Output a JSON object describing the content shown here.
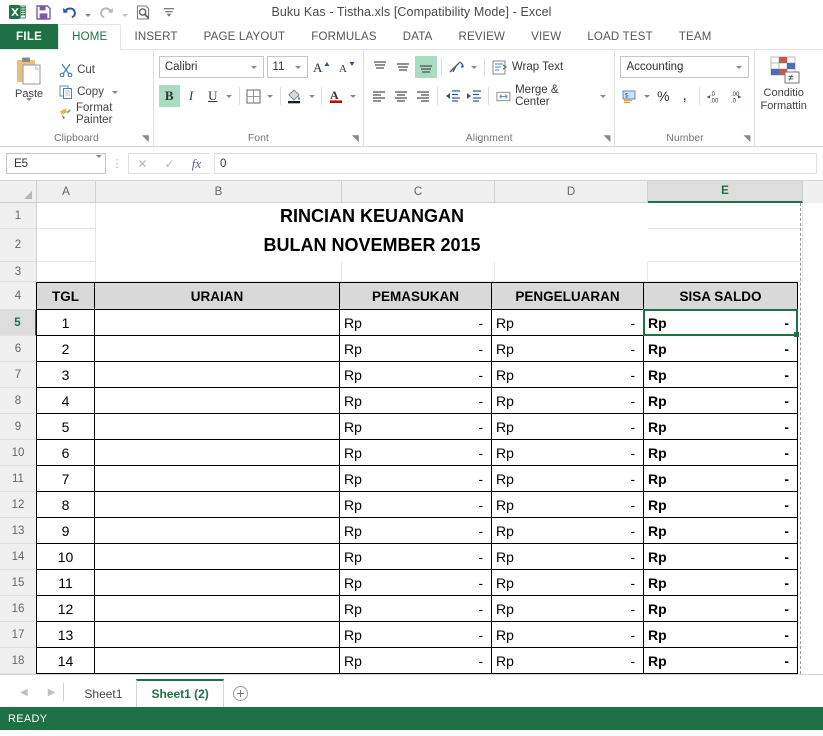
{
  "window": {
    "title": "Buku Kas - Tistha.xls  [Compatibility Mode] - Excel",
    "accent_color": "#1e7145"
  },
  "qat": {
    "items": [
      {
        "name": "excel-logo-icon",
        "label": "X"
      },
      {
        "name": "save-icon",
        "label": "Save"
      },
      {
        "name": "undo-icon",
        "label": "Undo"
      },
      {
        "name": "redo-icon",
        "label": "Redo"
      },
      {
        "name": "print-preview-icon",
        "label": "Print Preview and Print"
      },
      {
        "name": "customize-qat-icon",
        "label": "Customize Quick Access Toolbar"
      }
    ]
  },
  "ribbon": {
    "tabs": [
      {
        "label": "FILE",
        "active": false
      },
      {
        "label": "HOME",
        "active": true
      },
      {
        "label": "INSERT",
        "active": false
      },
      {
        "label": "PAGE LAYOUT",
        "active": false
      },
      {
        "label": "FORMULAS",
        "active": false
      },
      {
        "label": "DATA",
        "active": false
      },
      {
        "label": "REVIEW",
        "active": false
      },
      {
        "label": "VIEW",
        "active": false
      },
      {
        "label": "LOAD TEST",
        "active": false
      },
      {
        "label": "TEAM",
        "active": false
      }
    ],
    "clipboard": {
      "group_label": "Clipboard",
      "paste_label": "Paste",
      "cut_label": "Cut",
      "copy_label": "Copy",
      "format_painter_label": "Format Painter"
    },
    "font": {
      "group_label": "Font",
      "font_name": "Calibri",
      "font_size": "11",
      "bold_label": "B",
      "italic_label": "I",
      "underline_label": "U",
      "grow_font_label": "A",
      "shrink_font_label": "A",
      "borders_label": "Borders",
      "fill_color_label": "Fill Color",
      "font_color_label": "A",
      "bold_active": true
    },
    "alignment": {
      "group_label": "Alignment",
      "wrap_text_label": "Wrap Text",
      "merge_center_label": "Merge & Center",
      "top_align_label": "Top Align",
      "middle_align_label": "Middle Align",
      "bottom_align_label": "Bottom Align",
      "orientation_label": "Orientation",
      "align_left_label": "Align Left",
      "align_center_label": "Center",
      "align_right_label": "Align Right",
      "decrease_indent_label": "Decrease Indent",
      "increase_indent_label": "Increase Indent"
    },
    "number": {
      "group_label": "Number",
      "format": "Accounting",
      "accounting_label": "Accounting Number Format",
      "percent_label": "%",
      "comma_label": ",",
      "increase_decimal_label": "Increase Decimal",
      "decrease_decimal_label": "Decrease Decimal"
    },
    "styles": {
      "conditional_formatting_line1": "Conditio",
      "conditional_formatting_line2": "Formattin"
    }
  },
  "formula_bar": {
    "name_box": "E5",
    "cancel_label": "Cancel",
    "enter_label": "Enter",
    "fx_label": "fx",
    "value": "0"
  },
  "grid": {
    "columns": [
      "A",
      "B",
      "C",
      "D",
      "E"
    ],
    "selected_column": "E",
    "selected_row": "5",
    "active_cell": "E5",
    "doc_title_line1": "RINCIAN KEUANGAN",
    "doc_title_line2": "BULAN NOVEMBER 2015",
    "headers": [
      "TGL",
      "URAIAN",
      "PEMASUKAN",
      "PENGELUARAN",
      "SISA SALDO"
    ],
    "currency_symbol": "Rp",
    "zero_dash": "-",
    "row_numbers": [
      "1",
      "2",
      "3",
      "4",
      "5",
      "6",
      "7",
      "8",
      "9",
      "10",
      "11",
      "12",
      "13",
      "14",
      "15",
      "16",
      "17",
      "18"
    ],
    "rows": [
      {
        "excel_row": "5",
        "tgl": "1",
        "uraian": "",
        "pemasukan": "-",
        "pengeluaran": "-",
        "sisa_saldo": "-"
      },
      {
        "excel_row": "6",
        "tgl": "2",
        "uraian": "",
        "pemasukan": "-",
        "pengeluaran": "-",
        "sisa_saldo": "-"
      },
      {
        "excel_row": "7",
        "tgl": "3",
        "uraian": "",
        "pemasukan": "-",
        "pengeluaran": "-",
        "sisa_saldo": "-"
      },
      {
        "excel_row": "8",
        "tgl": "4",
        "uraian": "",
        "pemasukan": "-",
        "pengeluaran": "-",
        "sisa_saldo": "-"
      },
      {
        "excel_row": "9",
        "tgl": "5",
        "uraian": "",
        "pemasukan": "-",
        "pengeluaran": "-",
        "sisa_saldo": "-"
      },
      {
        "excel_row": "10",
        "tgl": "6",
        "uraian": "",
        "pemasukan": "-",
        "pengeluaran": "-",
        "sisa_saldo": "-"
      },
      {
        "excel_row": "11",
        "tgl": "7",
        "uraian": "",
        "pemasukan": "-",
        "pengeluaran": "-",
        "sisa_saldo": "-"
      },
      {
        "excel_row": "12",
        "tgl": "8",
        "uraian": "",
        "pemasukan": "-",
        "pengeluaran": "-",
        "sisa_saldo": "-"
      },
      {
        "excel_row": "13",
        "tgl": "9",
        "uraian": "",
        "pemasukan": "-",
        "pengeluaran": "-",
        "sisa_saldo": "-"
      },
      {
        "excel_row": "14",
        "tgl": "10",
        "uraian": "",
        "pemasukan": "-",
        "pengeluaran": "-",
        "sisa_saldo": "-"
      },
      {
        "excel_row": "15",
        "tgl": "11",
        "uraian": "",
        "pemasukan": "-",
        "pengeluaran": "-",
        "sisa_saldo": "-"
      },
      {
        "excel_row": "16",
        "tgl": "12",
        "uraian": "",
        "pemasukan": "-",
        "pengeluaran": "-",
        "sisa_saldo": "-"
      },
      {
        "excel_row": "17",
        "tgl": "13",
        "uraian": "",
        "pemasukan": "-",
        "pengeluaran": "-",
        "sisa_saldo": "-"
      },
      {
        "excel_row": "18",
        "tgl": "14",
        "uraian": "",
        "pemasukan": "-",
        "pengeluaran": "-",
        "sisa_saldo": "-"
      }
    ]
  },
  "sheet_tabs": {
    "prev_label": "Previous Sheet",
    "next_label": "Next Sheet",
    "tabs": [
      {
        "label": "Sheet1",
        "active": false
      },
      {
        "label": "Sheet1 (2)",
        "active": true
      }
    ],
    "add_sheet_label": "New sheet"
  },
  "status_bar": {
    "status": "READY"
  }
}
